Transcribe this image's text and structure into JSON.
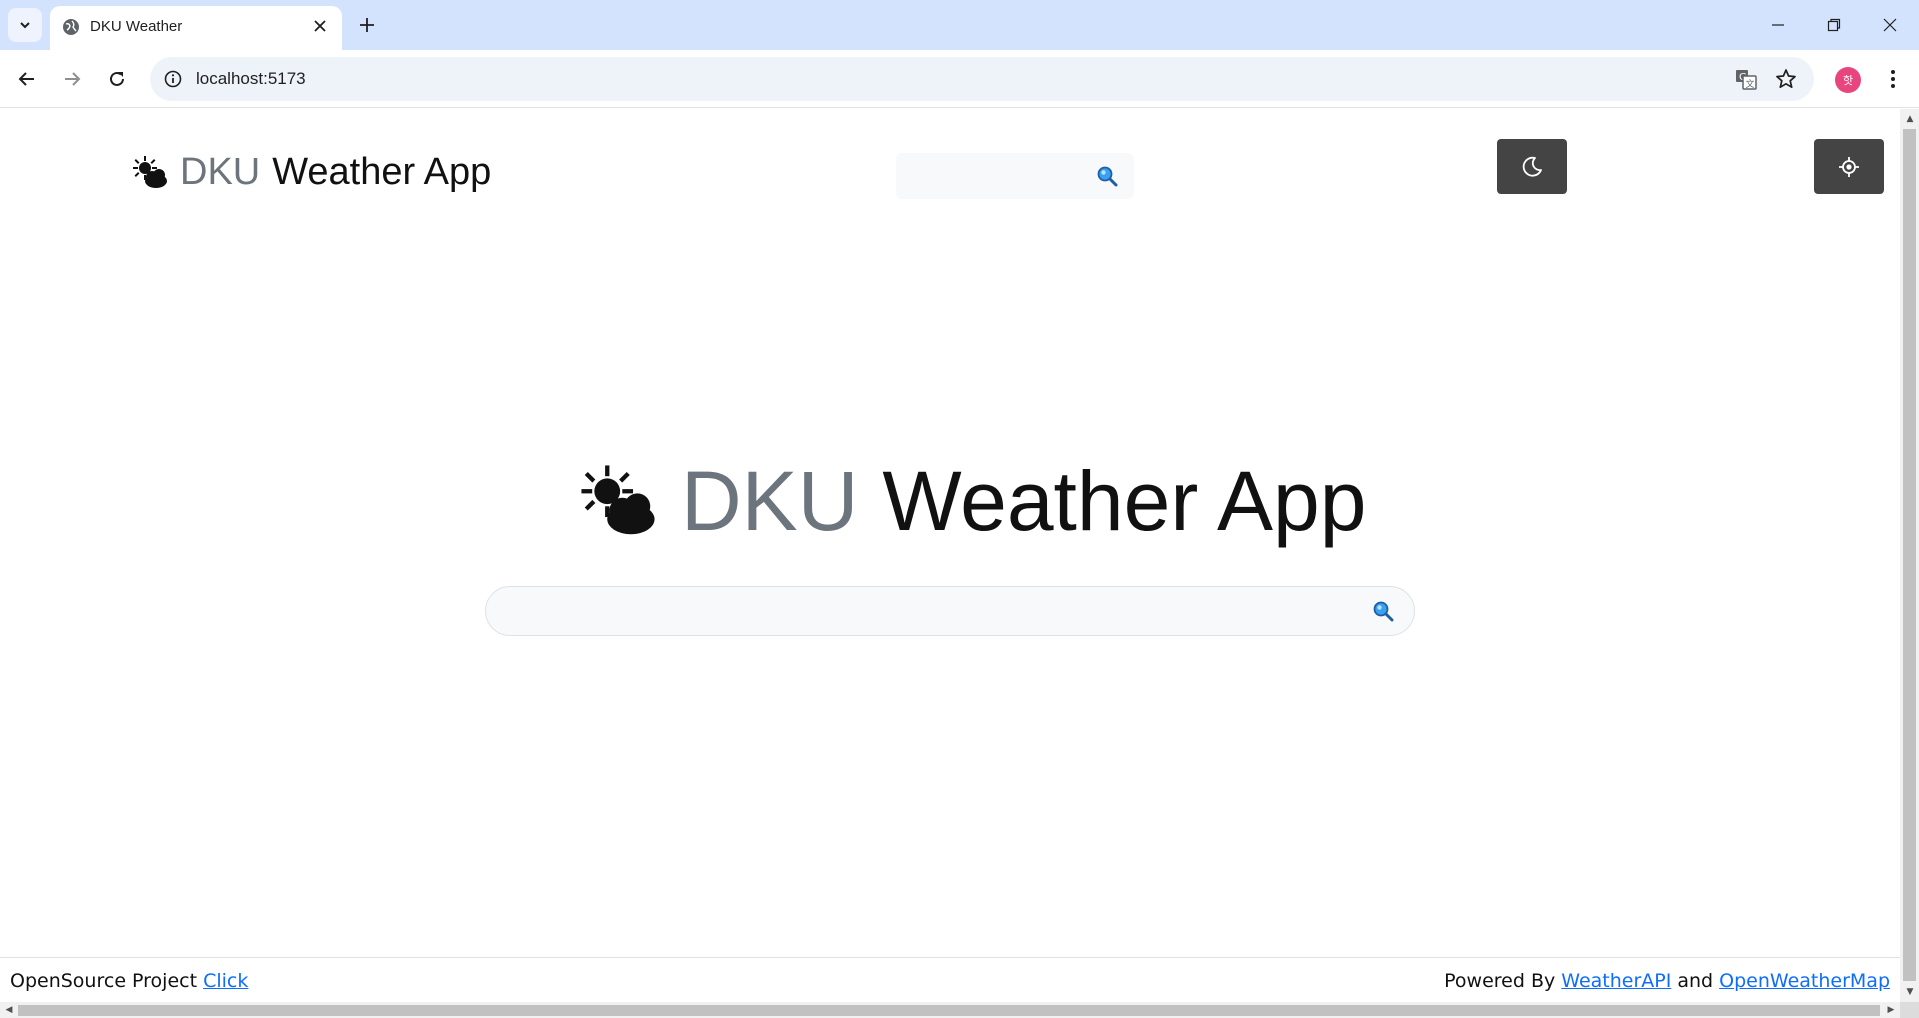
{
  "browser": {
    "tab_title": "DKU Weather",
    "url": "localhost:5173",
    "profile_initial": "핫",
    "colors": {
      "tabstrip": "#d3e3fd",
      "omnibox": "#eef2f9",
      "profile": "#e8457f"
    }
  },
  "header": {
    "brand_dku": "DKU",
    "brand_rest": "Weather App",
    "brand_icon": "sun-behind-cloud-icon",
    "search_placeholder": "",
    "dark_mode_icon": "moon-icon",
    "location_icon": "crosshair-icon"
  },
  "hero": {
    "title_dku": "DKU",
    "title_rest": "Weather App",
    "icon": "sun-behind-cloud-icon",
    "search_placeholder": ""
  },
  "footer": {
    "left_text": "OpenSource Project ",
    "left_link": "Click",
    "right_text": "Powered By ",
    "right_link1": "WeatherAPI",
    "right_and": " and ",
    "right_link2": "OpenWeatherMap"
  },
  "theme": {
    "muted_text": "#6c757d",
    "button_dark": "#444444",
    "link": "#0d6efd"
  }
}
